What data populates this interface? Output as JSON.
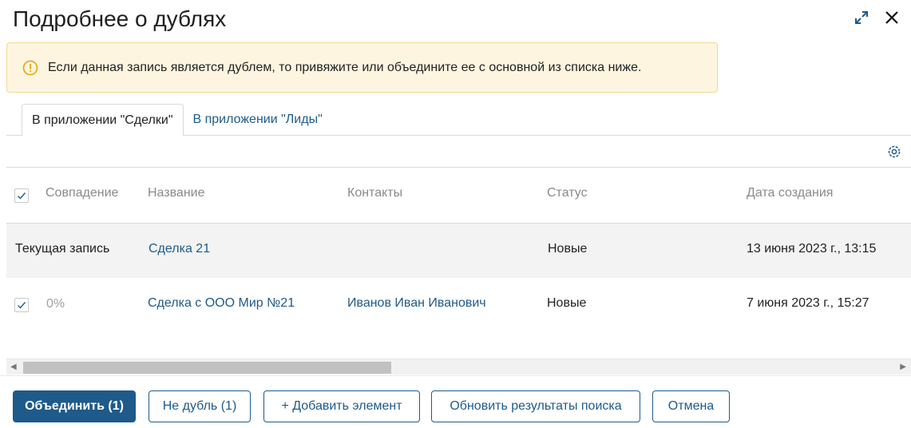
{
  "dialog": {
    "title": "Подробнее о дублях"
  },
  "alert": {
    "text": "Если данная запись является дублем, то привяжите или объедините ее с основной из списка ниже."
  },
  "tabs": [
    {
      "label": "В приложении \"Сделки\"",
      "active": true
    },
    {
      "label": "В приложении \"Лиды\"",
      "active": false
    }
  ],
  "table": {
    "headers": {
      "match": "Совпадение",
      "name": "Название",
      "contacts": "Контакты",
      "status": "Статус",
      "created": "Дата создания"
    },
    "current": {
      "label": "Текущая запись",
      "name": "Сделка 21",
      "contacts": "",
      "status": "Новые",
      "created": "13 июня 2023 г., 13:15"
    },
    "rows": [
      {
        "checked": true,
        "match": "0%",
        "name": "Сделка с ООО Мир №21",
        "contacts": "Иванов Иван Иванович",
        "status": "Новые",
        "created": "7 июня 2023 г., 15:27"
      }
    ]
  },
  "buttons": {
    "merge": "Объединить (1)",
    "not_duplicate": "Не дубль (1)",
    "add_item": "+ Добавить элемент",
    "refresh": "Обновить результаты поиска",
    "cancel": "Отмена"
  },
  "colors": {
    "accent": "#1e5a8a",
    "alert_bg": "#fdf5e0",
    "alert_border": "#f2d88f",
    "warning_icon": "#e6a700"
  },
  "icons": [
    "expand-icon",
    "close-icon",
    "warning-icon",
    "gear-icon",
    "check-icon",
    "scroll-left-icon",
    "scroll-right-icon"
  ]
}
